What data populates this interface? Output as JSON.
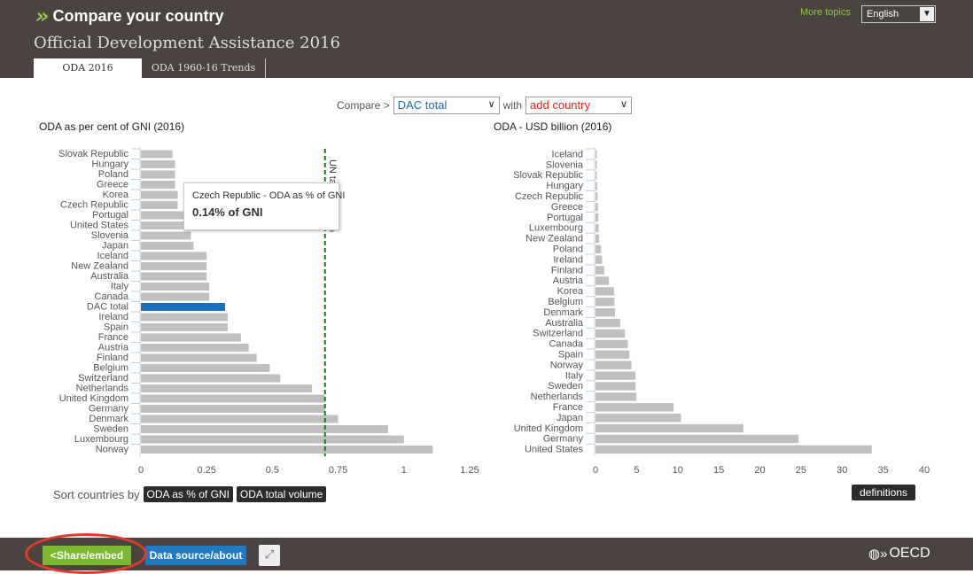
{
  "header": {
    "app_title": "Compare your country",
    "more_topics": "More topics",
    "language": "English",
    "page_title": "Official Development Assistance 2016",
    "tabs": [
      {
        "label": "ODA 2016",
        "active": true
      },
      {
        "label": "ODA 1960-16 Trends",
        "active": false
      }
    ]
  },
  "compare": {
    "label": "Compare >",
    "selected": "DAC total",
    "with_label": "with",
    "add_country": "add country"
  },
  "tooltip": {
    "title": "Czech Republic - ODA as % of GNI",
    "value": "0.14% of GNI"
  },
  "sort": {
    "label": "Sort countries by",
    "option1": "ODA as % of GNI",
    "option2": "ODA total volume"
  },
  "definitions": "definitions",
  "footer": {
    "share": "Share/embed",
    "data_source": "Data source/about",
    "oecd": "OECD"
  },
  "colors": {
    "bar": "#c0c0c0",
    "highlight": "#1a6fbf",
    "target_line": "#1a7a1a"
  },
  "chart_data": [
    {
      "type": "bar",
      "orientation": "horizontal",
      "title": "ODA as per cent of GNI (2016)",
      "categories": [
        "Slovak Republic",
        "Hungary",
        "Poland",
        "Greece",
        "Korea",
        "Czech Republic",
        "Portugal",
        "United States",
        "Slovenia",
        "Japan",
        "Iceland",
        "New Zealand",
        "Australia",
        "Italy",
        "Canada",
        "DAC total",
        "Ireland",
        "Spain",
        "France",
        "Austria",
        "Finland",
        "Belgium",
        "Switzerland",
        "Netherlands",
        "United Kingdom",
        "Germany",
        "Denmark",
        "Sweden",
        "Luxembourg",
        "Norway"
      ],
      "values": [
        0.12,
        0.13,
        0.13,
        0.13,
        0.14,
        0.14,
        0.17,
        0.18,
        0.19,
        0.2,
        0.25,
        0.25,
        0.25,
        0.26,
        0.26,
        0.32,
        0.33,
        0.33,
        0.38,
        0.41,
        0.44,
        0.49,
        0.53,
        0.65,
        0.7,
        0.7,
        0.75,
        0.94,
        1.0,
        1.11
      ],
      "highlight": "DAC total",
      "xlim": [
        0,
        1.25
      ],
      "xticks": [
        "0",
        "0.25",
        "0.5",
        "0.75",
        "1",
        "1.25"
      ],
      "reference_line": {
        "value": 0.7,
        "label": "UN target - 0.7%"
      }
    },
    {
      "type": "bar",
      "orientation": "horizontal",
      "title": "ODA - USD billion (2016)",
      "categories": [
        "Iceland",
        "Slovenia",
        "Slovak Republic",
        "Hungary",
        "Czech Republic",
        "Greece",
        "Portugal",
        "Luxembourg",
        "New Zealand",
        "Poland",
        "Ireland",
        "Finland",
        "Austria",
        "Korea",
        "Belgium",
        "Denmark",
        "Australia",
        "Switzerland",
        "Canada",
        "Spain",
        "Norway",
        "Italy",
        "Sweden",
        "Netherlands",
        "France",
        "Japan",
        "United Kingdom",
        "Germany",
        "United States"
      ],
      "values": [
        0.06,
        0.08,
        0.11,
        0.2,
        0.26,
        0.3,
        0.34,
        0.39,
        0.44,
        0.66,
        0.8,
        1.06,
        1.63,
        2.25,
        2.3,
        2.37,
        3.0,
        3.58,
        3.93,
        4.1,
        4.38,
        4.86,
        4.87,
        4.97,
        9.5,
        10.4,
        18.0,
        24.7,
        33.6
      ],
      "xlim": [
        0,
        40
      ],
      "xticks": [
        "0",
        "5",
        "10",
        "15",
        "20",
        "25",
        "30",
        "35",
        "40"
      ]
    }
  ]
}
